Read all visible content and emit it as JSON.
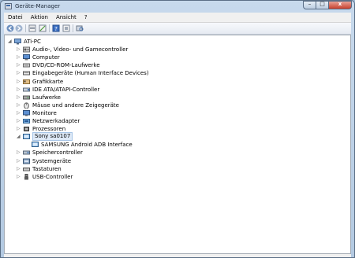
{
  "window": {
    "title": "Geräte-Manager",
    "close": "x"
  },
  "menu": [
    "Datei",
    "Aktion",
    "Ansicht",
    "?"
  ],
  "toolbar": [
    "back-arrow-icon",
    "forward-arrow-icon",
    "properties-icon",
    "update-driver-icon",
    "help-icon",
    "show-hidden-icon",
    "scan-hardware-icon"
  ],
  "tree": {
    "root": "ATi-PC",
    "items": [
      {
        "label": "Audio-, Video- und Gamecontroller",
        "icon": "audio-icon"
      },
      {
        "label": "Computer",
        "icon": "computer-icon"
      },
      {
        "label": "DVD/CD-ROM-Laufwerke",
        "icon": "dvd-drive-icon"
      },
      {
        "label": "Eingabegeräte (Human Interface Devices)",
        "icon": "hid-icon"
      },
      {
        "label": "Grafikkarte",
        "icon": "display-adapter-icon"
      },
      {
        "label": "IDE ATA/ATAPI-Controller",
        "icon": "ide-controller-icon"
      },
      {
        "label": "Laufwerke",
        "icon": "disk-drive-icon"
      },
      {
        "label": "Mäuse und andere Zeigegeräte",
        "icon": "mouse-icon"
      },
      {
        "label": "Monitore",
        "icon": "monitor-icon"
      },
      {
        "label": "Netzwerkadapter",
        "icon": "network-adapter-icon"
      },
      {
        "label": "Prozessoren",
        "icon": "processor-icon"
      },
      {
        "label": "Sony sa0107",
        "icon": "phone-device-icon",
        "expanded": true,
        "selected": true,
        "children": [
          {
            "label": "SAMSUNG Android ADB Interface",
            "icon": "adb-interface-icon"
          }
        ]
      },
      {
        "label": "Speichercontroller",
        "icon": "storage-controller-icon"
      },
      {
        "label": "Systemgeräte",
        "icon": "system-devices-icon"
      },
      {
        "label": "Tastaturen",
        "icon": "keyboard-icon"
      },
      {
        "label": "USB-Controller",
        "icon": "usb-icon"
      }
    ]
  }
}
